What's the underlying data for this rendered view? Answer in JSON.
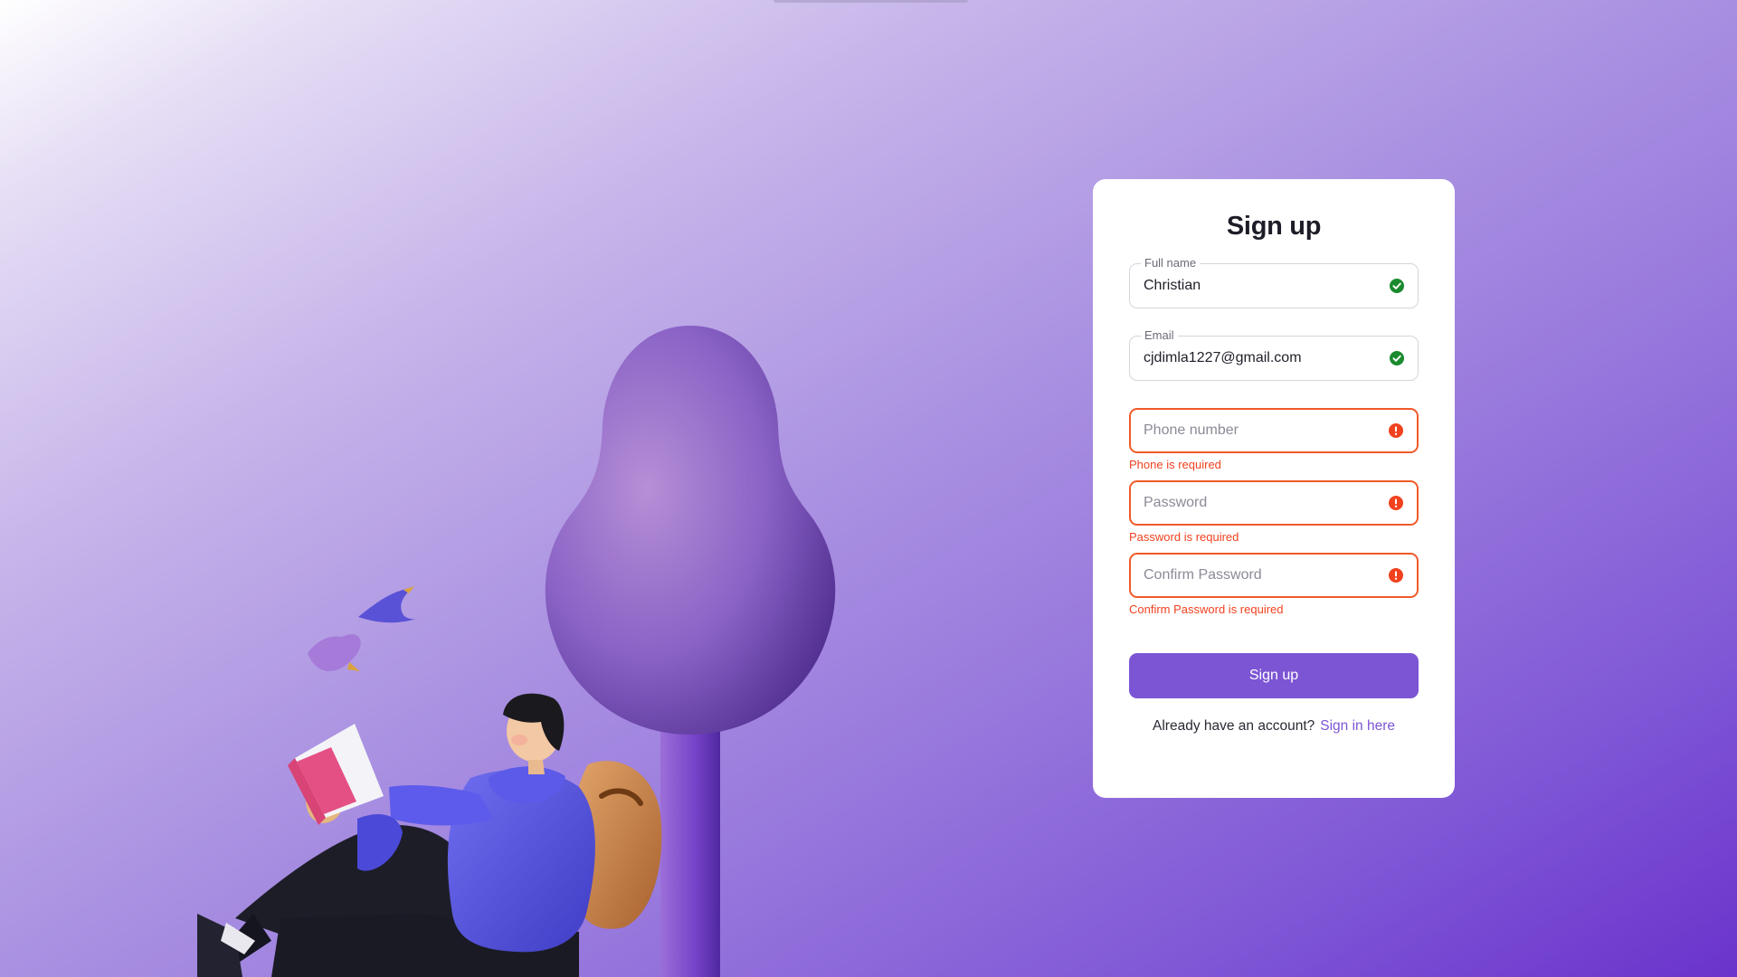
{
  "form": {
    "title": "Sign up",
    "full_name": {
      "label": "Full name",
      "value": "Christian",
      "status": "valid",
      "icon": "check-circle-icon"
    },
    "email": {
      "label": "Email",
      "value": "cjdimla1227@gmail.com",
      "status": "valid",
      "icon": "check-circle-icon"
    },
    "phone": {
      "placeholder": "Phone number",
      "error": "Phone is required",
      "status": "error",
      "icon": "alert-circle-icon"
    },
    "password": {
      "placeholder": "Password",
      "error": "Password is required",
      "status": "error",
      "icon": "alert-circle-icon"
    },
    "confirm_password": {
      "placeholder": "Confirm Password",
      "error": "Confirm Password is required",
      "status": "error",
      "icon": "alert-circle-icon"
    },
    "submit_label": "Sign up",
    "footer_text": "Already have an account?",
    "signin_link": "Sign in here"
  },
  "colors": {
    "accent": "#7c55d4",
    "error": "#f05a28",
    "valid": "#1a8a2e",
    "background_start": "#ffffff",
    "background_end": "#6a33cc"
  }
}
